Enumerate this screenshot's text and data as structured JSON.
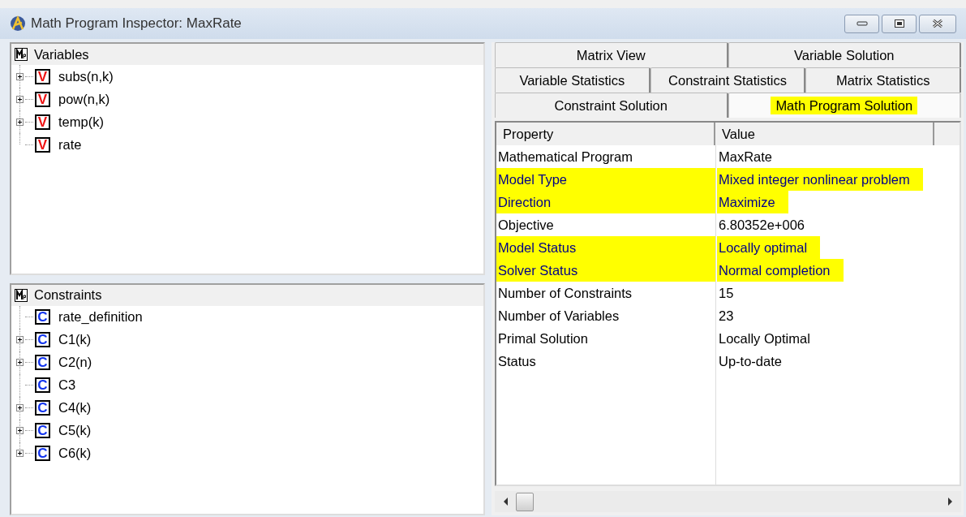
{
  "window": {
    "title": "Math Program Inspector: MaxRate"
  },
  "variables": {
    "title": "Variables",
    "items": [
      {
        "badge": "V",
        "label": "subs(n,k)",
        "expandable": true
      },
      {
        "badge": "V",
        "label": "pow(n,k)",
        "expandable": true
      },
      {
        "badge": "V",
        "label": "temp(k)",
        "expandable": true
      },
      {
        "badge": "V",
        "label": "rate",
        "expandable": false
      }
    ]
  },
  "constraints": {
    "title": "Constraints",
    "items": [
      {
        "badge": "C",
        "label": "rate_definition",
        "expandable": false
      },
      {
        "badge": "C",
        "label": "C1(k)",
        "expandable": true
      },
      {
        "badge": "C",
        "label": "C2(n)",
        "expandable": true
      },
      {
        "badge": "C",
        "label": "C3",
        "expandable": false
      },
      {
        "badge": "C",
        "label": "C4(k)",
        "expandable": true
      },
      {
        "badge": "C",
        "label": "C5(k)",
        "expandable": true
      },
      {
        "badge": "C",
        "label": "C6(k)",
        "expandable": true
      }
    ]
  },
  "tab_rows": [
    [
      {
        "label": "Matrix View",
        "selected": false
      },
      {
        "label": "Variable Solution",
        "selected": false
      }
    ],
    [
      {
        "label": "Variable Statistics",
        "selected": false
      },
      {
        "label": "Constraint Statistics",
        "selected": false
      },
      {
        "label": "Matrix Statistics",
        "selected": false
      }
    ],
    [
      {
        "label": "Constraint Solution",
        "selected": false
      },
      {
        "label": "Math Program Solution",
        "selected": true
      }
    ]
  ],
  "table": {
    "columns": [
      "Property",
      "Value"
    ],
    "rows": [
      {
        "property": "Mathematical Program",
        "value": "MaxRate",
        "highlighted": false
      },
      {
        "property": "Model Type",
        "value": "Mixed integer nonlinear problem",
        "highlighted": true
      },
      {
        "property": "Direction",
        "value": "Maximize",
        "highlighted": true
      },
      {
        "property": "Objective",
        "value": "6.80352e+006",
        "highlighted": false
      },
      {
        "property": "Model Status",
        "value": "Locally optimal",
        "highlighted": true
      },
      {
        "property": "Solver Status",
        "value": "Normal completion",
        "highlighted": true
      },
      {
        "property": "Number of Constraints",
        "value": "15",
        "highlighted": false
      },
      {
        "property": "Number of Variables",
        "value": "23",
        "highlighted": false
      },
      {
        "property": "Primal Solution",
        "value": "Locally Optimal",
        "highlighted": false
      },
      {
        "property": "Status",
        "value": "Up-to-date",
        "highlighted": false
      }
    ]
  }
}
